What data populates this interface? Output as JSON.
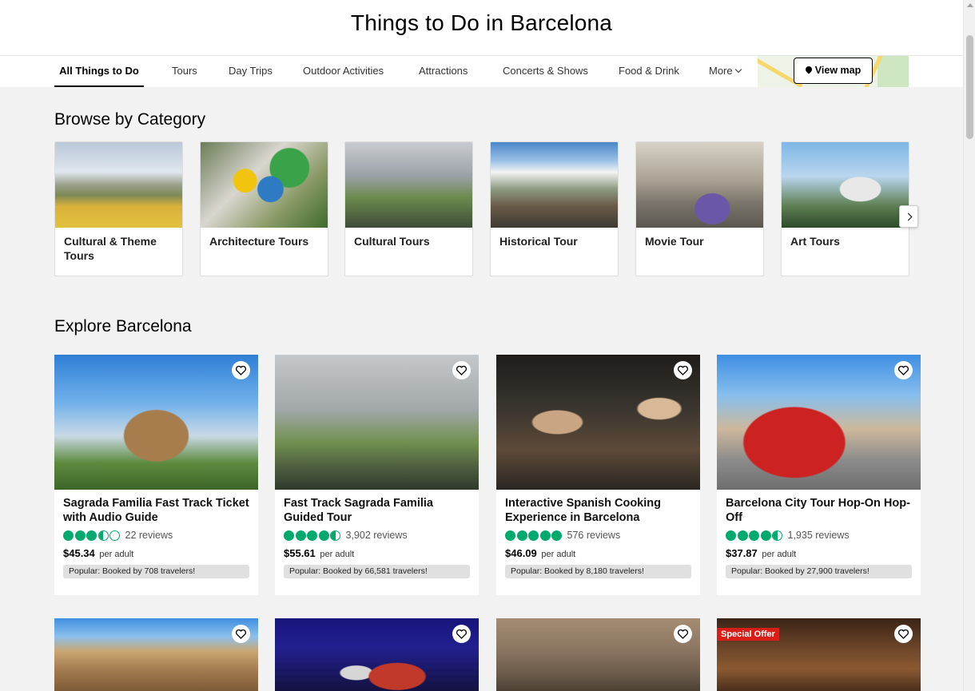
{
  "page": {
    "title": "Things to Do in Barcelona"
  },
  "tabs": [
    {
      "label": "All Things to Do",
      "active": true
    },
    {
      "label": "Tours"
    },
    {
      "label": "Day Trips"
    },
    {
      "label": "Outdoor Activities"
    },
    {
      "label": "Attractions"
    },
    {
      "label": "Concerts & Shows"
    },
    {
      "label": "Food & Drink"
    },
    {
      "label": "More"
    }
  ],
  "map": {
    "view_map_label": "View map"
  },
  "browse": {
    "heading": "Browse by Category",
    "categories": [
      {
        "label": "Cultural & Theme Tours"
      },
      {
        "label": "Architecture Tours"
      },
      {
        "label": "Cultural Tours"
      },
      {
        "label": "Historical Tour"
      },
      {
        "label": "Movie Tour"
      },
      {
        "label": "Art Tours"
      }
    ]
  },
  "explore": {
    "heading": "Explore Barcelona",
    "products": [
      {
        "title": "Sagrada Familia Fast Track Ticket with Audio Guide",
        "rating": 3.5,
        "reviews": "22 reviews",
        "price": "$45.34",
        "per": "per adult",
        "popular": "Popular: Booked by 708 travelers!"
      },
      {
        "title": "Fast Track Sagrada Familia Guided Tour",
        "rating": 4.5,
        "reviews": "3,902 reviews",
        "price": "$55.61",
        "per": "per adult",
        "popular": "Popular: Booked by 66,581 travelers!"
      },
      {
        "title": "Interactive Spanish Cooking Experience in Barcelona",
        "rating": 5,
        "reviews": "576 reviews",
        "price": "$46.09",
        "per": "per adult",
        "popular": "Popular: Booked by 8,180 travelers!"
      },
      {
        "title": "Barcelona City Tour Hop-On Hop-Off",
        "rating": 4.5,
        "reviews": "1,935 reviews",
        "price": "$37.87",
        "per": "per adult",
        "popular": "Popular: Booked by 27,900 travelers!"
      }
    ],
    "special_offer_label": "Special Offer"
  },
  "colors": {
    "rating_green": "#00aa6c",
    "offer_red": "#d91e18"
  }
}
